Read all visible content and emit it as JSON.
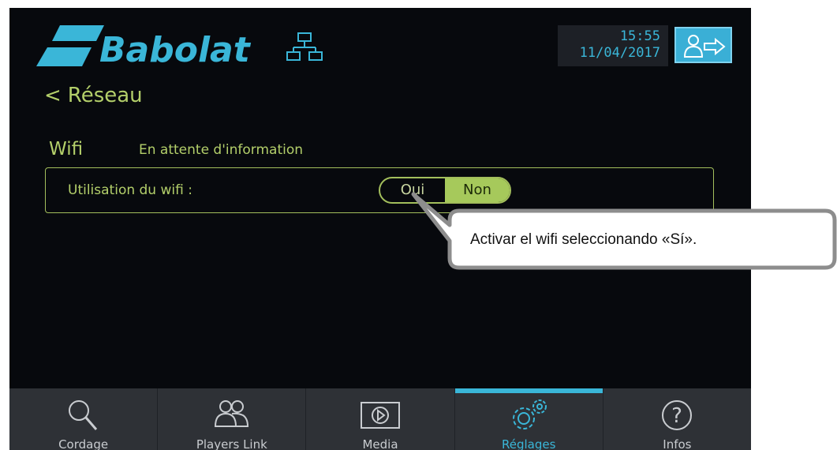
{
  "header": {
    "brand": "Babolat",
    "time": "15:55",
    "date": "11/04/2017",
    "network_icon": "network-icon",
    "logout_icon": "user-logout-icon"
  },
  "nav": {
    "back_label": "Réseau"
  },
  "wifi": {
    "title": "Wifi",
    "status": "En attente d'information",
    "usage_label": "Utilisation du wifi :",
    "option_yes": "Oui",
    "option_no": "Non",
    "selected": "Non"
  },
  "bottom_nav": {
    "items": [
      {
        "label": "Cordage",
        "icon": "racket-icon"
      },
      {
        "label": "Players Link",
        "icon": "players-icon"
      },
      {
        "label": "Media",
        "icon": "play-icon"
      },
      {
        "label": "Réglages",
        "icon": "gears-icon",
        "active": true
      },
      {
        "label": "Infos",
        "icon": "help-icon"
      }
    ]
  },
  "callout": {
    "text": "Activar el wifi seleccionando «Sí»."
  },
  "colors": {
    "accent_blue": "#3ab6d8",
    "accent_green": "#a6c95b",
    "background": "#07090d"
  }
}
